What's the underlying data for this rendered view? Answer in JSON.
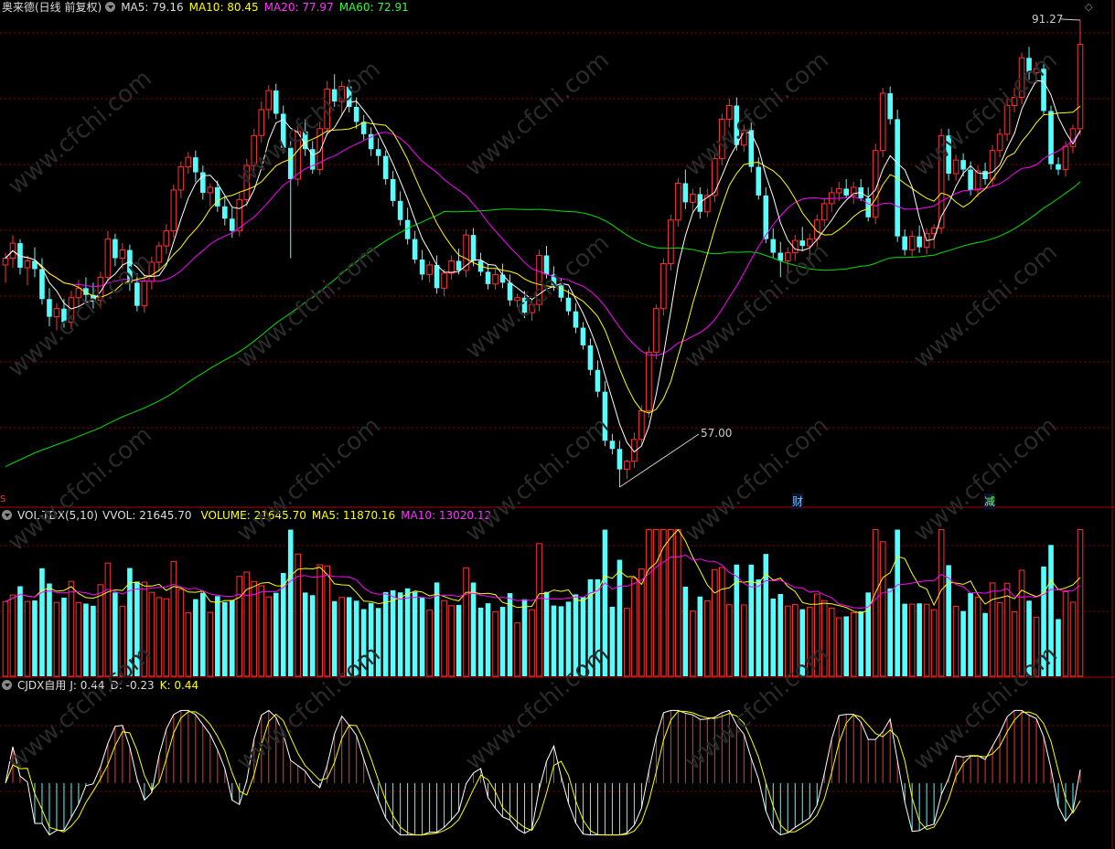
{
  "main_panel": {
    "title": "奥来德(日线 前复权)",
    "ma5_label": "MA5: 79.16",
    "ma10_label": "MA10: 80.45",
    "ma20_label": "MA20: 77.97",
    "ma60_label": "MA60: 72.91",
    "high_label": "91.27",
    "low_label": "57.00",
    "event_marks": [
      "财",
      "减"
    ],
    "left_marker": "S"
  },
  "volume_panel": {
    "title": "VOL-TDX(5,10)",
    "vvol_label": "VVOL: 21645.70",
    "volume_label": "VOLUME: 21645.70",
    "ma5_label": "MA5: 11870.16",
    "ma10_label": "MA10: 13020.12"
  },
  "indicator_panel": {
    "title": "CJDX自用",
    "j_label": "J: 0.44",
    "d_label": "D: -0.23",
    "k_label": "K: 0.44"
  },
  "watermark": "www.cfchi.com",
  "colors": {
    "up": "#ff3232",
    "down": "#54ffff",
    "ma5": "#ffffff",
    "ma10": "#ffff00",
    "ma20": "#ff00ff",
    "ma60": "#00e000",
    "grid": "#8b0000",
    "border": "#b00000"
  },
  "chart_data": {
    "type": "candlestick",
    "price_range": [
      57.0,
      91.27
    ],
    "candles": [
      [
        73.3,
        74.2,
        72.0,
        73.8
      ],
      [
        73.8,
        75.5,
        73.1,
        74.9
      ],
      [
        74.9,
        75.2,
        72.6,
        73.1
      ],
      [
        73.1,
        74.0,
        71.8,
        73.6
      ],
      [
        73.6,
        74.6,
        72.4,
        73.0
      ],
      [
        73.0,
        73.8,
        70.4,
        70.8
      ],
      [
        70.8,
        71.6,
        68.8,
        69.5
      ],
      [
        69.5,
        70.5,
        68.5,
        70.1
      ],
      [
        70.1,
        70.8,
        68.7,
        69.1
      ],
      [
        69.1,
        71.4,
        68.6,
        70.9
      ],
      [
        70.9,
        72.2,
        70.2,
        71.6
      ],
      [
        71.6,
        72.4,
        70.4,
        71.1
      ],
      [
        71.1,
        72.0,
        70.1,
        70.7
      ],
      [
        70.7,
        72.8,
        70.1,
        72.4
      ],
      [
        72.4,
        75.8,
        72.1,
        75.2
      ],
      [
        75.2,
        75.6,
        73.2,
        73.8
      ],
      [
        73.8,
        74.9,
        73.0,
        74.4
      ],
      [
        74.4,
        74.8,
        71.4,
        72.0
      ],
      [
        72.0,
        72.7,
        69.9,
        70.3
      ],
      [
        70.3,
        72.6,
        69.8,
        72.1
      ],
      [
        72.1,
        73.9,
        71.5,
        73.5
      ],
      [
        73.5,
        75.0,
        72.8,
        74.7
      ],
      [
        74.7,
        76.3,
        74.1,
        75.8
      ],
      [
        75.8,
        79.2,
        75.3,
        78.8
      ],
      [
        78.8,
        80.9,
        78.2,
        80.5
      ],
      [
        80.5,
        81.6,
        80.0,
        81.2
      ],
      [
        81.2,
        81.7,
        79.4,
        80.1
      ],
      [
        80.1,
        80.6,
        78.1,
        78.6
      ],
      [
        78.6,
        79.3,
        77.6,
        79.0
      ],
      [
        79.0,
        79.5,
        77.2,
        77.6
      ],
      [
        77.6,
        78.3,
        76.2,
        76.7
      ],
      [
        76.7,
        77.5,
        75.3,
        75.8
      ],
      [
        75.8,
        78.6,
        75.4,
        78.1
      ],
      [
        78.1,
        81.1,
        77.6,
        80.6
      ],
      [
        80.6,
        83.3,
        80.2,
        82.8
      ],
      [
        82.8,
        85.3,
        82.3,
        84.7
      ],
      [
        84.7,
        86.5,
        84.0,
        86.1
      ],
      [
        86.1,
        86.6,
        84.0,
        84.4
      ],
      [
        84.4,
        85.0,
        81.5,
        81.9
      ],
      [
        81.9,
        82.4,
        73.8,
        79.6
      ],
      [
        79.6,
        83.5,
        79.1,
        83.1
      ],
      [
        83.1,
        84.0,
        81.3,
        81.8
      ],
      [
        81.8,
        82.4,
        80.0,
        80.3
      ],
      [
        80.3,
        83.8,
        79.9,
        83.3
      ],
      [
        83.3,
        86.8,
        82.8,
        86.2
      ],
      [
        86.2,
        87.3,
        84.9,
        85.3
      ],
      [
        85.3,
        86.8,
        84.2,
        86.4
      ],
      [
        86.4,
        86.9,
        84.5,
        84.9
      ],
      [
        84.9,
        85.6,
        83.3,
        83.8
      ],
      [
        83.8,
        84.3,
        82.5,
        82.9
      ],
      [
        82.9,
        83.4,
        81.3,
        81.8
      ],
      [
        81.8,
        82.6,
        80.6,
        81.3
      ],
      [
        81.3,
        81.7,
        79.2,
        79.6
      ],
      [
        79.6,
        80.2,
        77.6,
        78.0
      ],
      [
        78.0,
        78.7,
        76.2,
        76.6
      ],
      [
        76.6,
        77.5,
        74.8,
        75.2
      ],
      [
        75.2,
        75.8,
        73.4,
        73.7
      ],
      [
        73.7,
        74.4,
        72.2,
        72.6
      ],
      [
        72.6,
        73.6,
        72.0,
        73.3
      ],
      [
        73.3,
        74.0,
        71.2,
        71.6
      ],
      [
        71.6,
        73.0,
        71.0,
        72.7
      ],
      [
        72.7,
        74.0,
        72.2,
        73.6
      ],
      [
        73.6,
        74.5,
        72.6,
        72.9
      ],
      [
        72.9,
        75.9,
        72.4,
        75.5
      ],
      [
        75.5,
        76.0,
        73.2,
        73.6
      ],
      [
        73.6,
        74.2,
        72.5,
        72.8
      ],
      [
        72.8,
        73.4,
        71.5,
        71.9
      ],
      [
        71.9,
        73.0,
        71.5,
        72.6
      ],
      [
        72.6,
        73.4,
        71.6,
        72.0
      ],
      [
        72.0,
        72.6,
        70.3,
        70.7
      ],
      [
        70.7,
        71.2,
        70.2,
        70.9
      ],
      [
        70.9,
        71.4,
        69.4,
        69.8
      ],
      [
        69.8,
        70.8,
        69.2,
        70.4
      ],
      [
        70.4,
        74.4,
        69.9,
        74.0
      ],
      [
        74.0,
        74.7,
        72.3,
        72.6
      ],
      [
        72.6,
        73.2,
        71.4,
        71.8
      ],
      [
        71.8,
        72.3,
        70.6,
        70.9
      ],
      [
        70.9,
        71.5,
        69.6,
        69.9
      ],
      [
        69.9,
        70.5,
        68.3,
        68.7
      ],
      [
        68.7,
        69.1,
        67.1,
        67.4
      ],
      [
        67.4,
        67.9,
        65.2,
        65.6
      ],
      [
        65.6,
        66.3,
        63.6,
        64.0
      ],
      [
        64.0,
        64.8,
        60.0,
        60.4
      ],
      [
        60.4,
        60.9,
        59.4,
        59.8
      ],
      [
        59.8,
        60.4,
        57.0,
        58.3
      ],
      [
        58.3,
        59.0,
        57.6,
        58.9
      ],
      [
        58.9,
        61.0,
        58.4,
        60.5
      ],
      [
        60.5,
        63.0,
        60.0,
        62.6
      ],
      [
        62.6,
        67.3,
        62.1,
        66.9
      ],
      [
        66.9,
        70.4,
        66.4,
        70.1
      ],
      [
        70.1,
        73.8,
        69.6,
        73.4
      ],
      [
        73.4,
        77.0,
        72.9,
        76.6
      ],
      [
        76.6,
        79.7,
        76.1,
        79.3
      ],
      [
        79.3,
        80.3,
        77.4,
        77.9
      ],
      [
        77.9,
        78.9,
        77.2,
        78.5
      ],
      [
        78.5,
        79.0,
        76.7,
        77.2
      ],
      [
        77.2,
        78.9,
        76.8,
        78.4
      ],
      [
        78.4,
        81.5,
        77.9,
        81.1
      ],
      [
        81.1,
        84.4,
        80.6,
        84.0
      ],
      [
        84.0,
        85.5,
        83.4,
        85.0
      ],
      [
        85.0,
        85.6,
        81.7,
        82.1
      ],
      [
        82.1,
        83.6,
        81.6,
        83.2
      ],
      [
        83.2,
        84.0,
        80.1,
        80.5
      ],
      [
        80.5,
        81.2,
        78.1,
        78.4
      ],
      [
        78.4,
        79.0,
        74.9,
        75.2
      ],
      [
        75.2,
        76.0,
        73.8,
        74.2
      ],
      [
        74.2,
        75.0,
        72.4,
        73.6
      ],
      [
        73.6,
        74.6,
        72.7,
        74.2
      ],
      [
        74.2,
        75.5,
        73.6,
        75.1
      ],
      [
        75.1,
        76.1,
        74.3,
        74.7
      ],
      [
        74.7,
        75.6,
        73.7,
        75.2
      ],
      [
        75.2,
        77.0,
        74.6,
        76.6
      ],
      [
        76.6,
        78.2,
        76.1,
        77.8
      ],
      [
        77.8,
        79.0,
        77.2,
        78.6
      ],
      [
        78.6,
        79.4,
        78.0,
        78.9
      ],
      [
        78.9,
        79.6,
        78.2,
        78.4
      ],
      [
        78.4,
        79.4,
        77.8,
        79.0
      ],
      [
        79.0,
        79.6,
        78.0,
        78.2
      ],
      [
        78.2,
        79.0,
        76.5,
        76.8
      ],
      [
        76.8,
        82.2,
        76.3,
        81.7
      ],
      [
        81.7,
        86.3,
        81.2,
        85.9
      ],
      [
        85.9,
        86.4,
        83.6,
        84.0
      ],
      [
        84.0,
        84.7,
        75.0,
        75.4
      ],
      [
        75.4,
        75.9,
        74.0,
        74.4
      ],
      [
        74.4,
        75.8,
        73.9,
        75.4
      ],
      [
        75.4,
        76.2,
        74.2,
        74.6
      ],
      [
        74.6,
        76.0,
        74.1,
        75.6
      ],
      [
        75.6,
        76.3,
        74.5,
        76.0
      ],
      [
        76.0,
        83.3,
        75.6,
        82.8
      ],
      [
        82.8,
        83.3,
        79.5,
        80.0
      ],
      [
        80.0,
        81.4,
        79.5,
        81.0
      ],
      [
        81.0,
        81.5,
        79.8,
        80.3
      ],
      [
        80.3,
        80.9,
        78.4,
        78.8
      ],
      [
        78.8,
        80.6,
        78.3,
        80.2
      ],
      [
        80.2,
        80.8,
        79.2,
        79.6
      ],
      [
        79.6,
        82.1,
        79.1,
        81.7
      ],
      [
        81.7,
        83.3,
        81.2,
        82.9
      ],
      [
        82.9,
        85.5,
        82.4,
        85.0
      ],
      [
        85.0,
        86.3,
        84.5,
        85.6
      ],
      [
        85.6,
        88.9,
        85.1,
        88.5
      ],
      [
        88.5,
        89.3,
        86.9,
        87.4
      ],
      [
        87.4,
        88.2,
        86.6,
        87.7
      ],
      [
        87.7,
        88.1,
        84.3,
        84.6
      ],
      [
        84.6,
        85.0,
        80.3,
        80.7
      ],
      [
        80.7,
        81.2,
        79.9,
        80.3
      ],
      [
        80.3,
        82.4,
        79.8,
        82.0
      ],
      [
        82.0,
        83.6,
        81.5,
        83.3
      ],
      [
        83.3,
        91.27,
        82.8,
        89.5
      ]
    ],
    "volume_range": [
      0,
      21645.7
    ],
    "volumes_note": "volume bars in 10k-share units, last bar = 21645.70",
    "indicator_range": [
      -1.2,
      1.6
    ]
  }
}
